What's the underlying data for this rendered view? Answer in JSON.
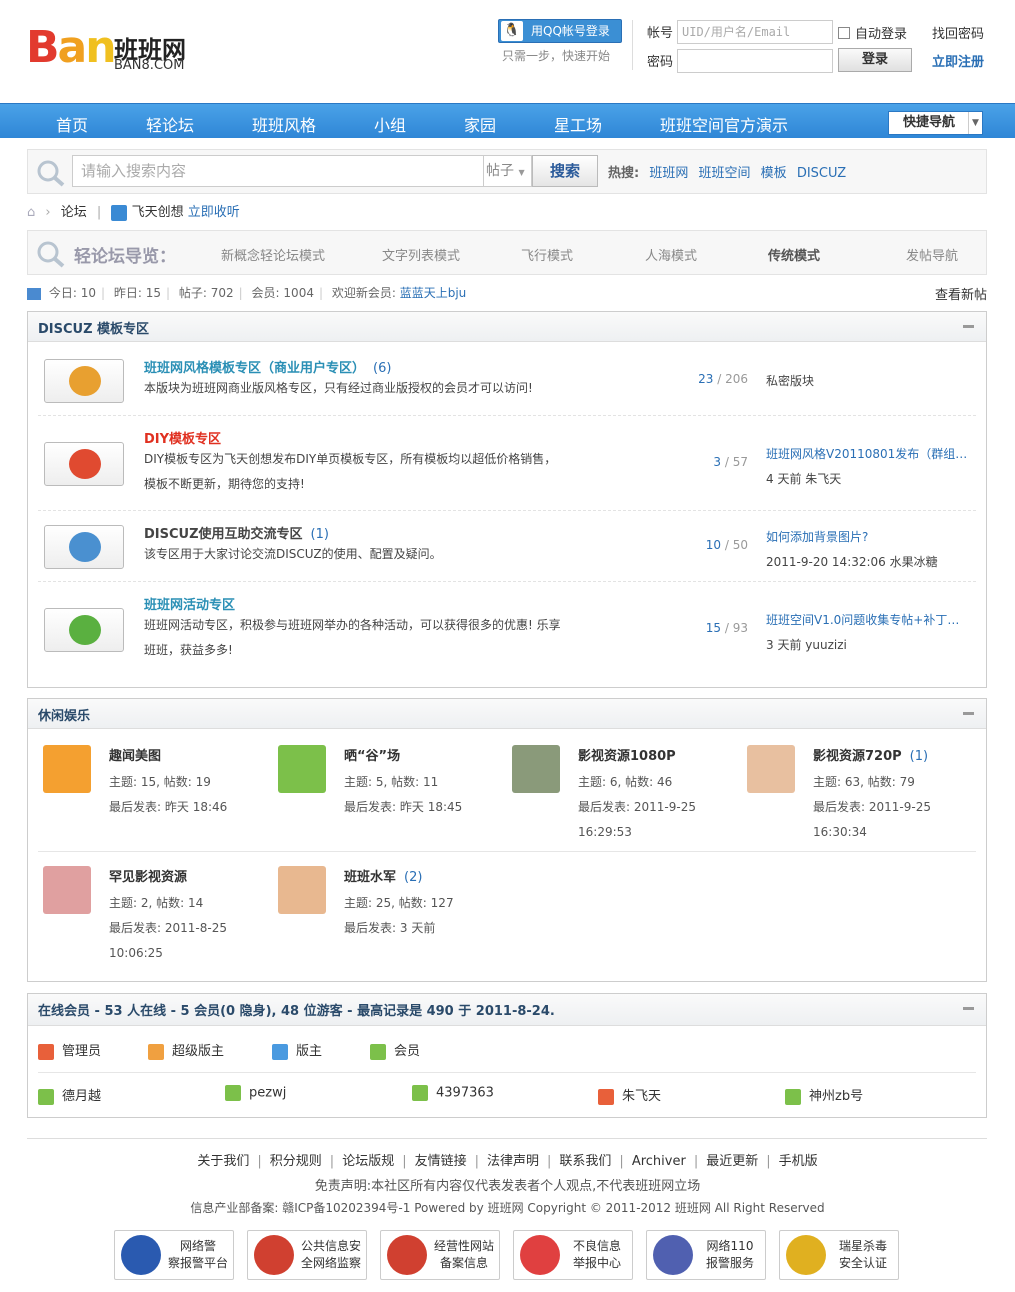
{
  "header": {
    "logo_text": "Ban",
    "logo_cn": "班班网",
    "logo_en": "BAN8.COM",
    "qq_login": "用QQ帐号登录",
    "qq_tip": "只需一步，快速开始",
    "account_label": "帐号",
    "account_placeholder": "UID/用户名/Email",
    "password_label": "密码",
    "auto_login": "自动登录",
    "login_btn": "登录",
    "forgot": "找回密码",
    "register": "立即注册"
  },
  "nav": {
    "items": [
      "首页",
      "轻论坛",
      "班班风格",
      "小组",
      "家园",
      "星工场",
      "班班空间官方演示"
    ],
    "quick": "快捷导航"
  },
  "search": {
    "placeholder": "请输入搜索内容",
    "type": "帖子",
    "button": "搜索",
    "hot_label": "热搜:",
    "hot": [
      "班班网",
      "班班空间",
      "模板",
      "DISCUZ"
    ]
  },
  "breadcrumb": {
    "forum": "论坛",
    "radio": "飞天创想",
    "listen": "立即收听"
  },
  "guide": {
    "title": "轻论坛导览：",
    "items": [
      "新概念轻论坛模式",
      "文字列表模式",
      "飞行模式",
      "人海模式",
      "传统模式",
      "发帖导航"
    ]
  },
  "stats": {
    "today_label": "今日:",
    "today": "10",
    "yesterday_label": "昨日:",
    "yesterday": "15",
    "posts_label": "帖子:",
    "posts": "702",
    "members_label": "会员:",
    "members": "1004",
    "welcome_label": "欢迎新会员:",
    "newest": "蓝蓝天上bju",
    "new_posts": "查看新帖"
  },
  "discuz": {
    "title": "DISCUZ 模板专区",
    "forums": [
      {
        "name": "班班网风格模板专区（商业用户专区）",
        "count": "(6)",
        "desc1": "本版块为班班网商业版风格专区，只有经过商业版授权的会员才可以访问!",
        "desc2": "",
        "topics": "23",
        "posts": "206",
        "last_title": "私密版块",
        "last_time": "",
        "last_user": "",
        "color": "#2a8fb5"
      },
      {
        "name": "DIY模板专区",
        "count": "",
        "desc1": "DIY模板专区为飞天创想发布DIY单页模板专区，所有模板均以超低价格销售，",
        "desc2": "模板不断更新，期待您的支持!",
        "topics": "3",
        "posts": "57",
        "last_title": "班班网风格V20110801发布（群组…",
        "last_time": "4 天前",
        "last_user": "朱飞天",
        "color": "#e03020"
      },
      {
        "name": "DISCUZ使用互助交流专区",
        "count": "(1)",
        "desc1": "该专区用于大家讨论交流DISCUZ的使用、配置及疑问。",
        "desc2": "",
        "topics": "10",
        "posts": "50",
        "last_title": "如何添加背景图片?",
        "last_time": "2011-9-20 14:32:06",
        "last_user": "水果冰糖",
        "color": "#444444"
      },
      {
        "name": "班班网活动专区",
        "count": "",
        "desc1": "班班网活动专区，积极参与班班网举办的各种活动，可以获得很多的优惠! 乐享",
        "desc2": "班班，获益多多!",
        "topics": "15",
        "posts": "93",
        "last_title": "班班空间V1.0问题收集专帖+补丁…",
        "last_time": "3 天前",
        "last_user": "yuuzizi",
        "color": "#2a8fb5"
      }
    ]
  },
  "leisure": {
    "title": "休闲娱乐",
    "groups": [
      {
        "name": "趣闻美图",
        "count": "",
        "topics_label": "主题:",
        "topics": "15",
        "posts_label": "帖数:",
        "posts": "19",
        "last_label": "最后发表:",
        "last": "昨天 18:46",
        "last2": "",
        "color": "#f4a030"
      },
      {
        "name": "晒“谷”场",
        "count": "",
        "topics_label": "主题:",
        "topics": "5",
        "posts_label": "帖数:",
        "posts": "11",
        "last_label": "最后发表:",
        "last": "昨天 18:45",
        "last2": "",
        "color": "#7cc04a"
      },
      {
        "name": "影视资源1080P",
        "count": "",
        "topics_label": "主题:",
        "topics": "6",
        "posts_label": "帖数:",
        "posts": "46",
        "last_label": "最后发表:",
        "last": "2011-9-25",
        "last2": "16:29:53",
        "color": "#8a9a7a"
      },
      {
        "name": "影视资源720P",
        "count": "(1)",
        "topics_label": "主题:",
        "topics": "63",
        "posts_label": "帖数:",
        "posts": "79",
        "last_label": "最后发表:",
        "last": "2011-9-25",
        "last2": "16:30:34",
        "color": "#e8c0a0"
      },
      {
        "name": "罕见影视资源",
        "count": "",
        "topics_label": "主题:",
        "topics": "2",
        "posts_label": "帖数:",
        "posts": "14",
        "last_label": "最后发表:",
        "last": "2011-8-25",
        "last2": "10:06:25",
        "color": "#e0a0a0"
      },
      {
        "name": "班班水军",
        "count": "(2)",
        "topics_label": "主题:",
        "topics": "25",
        "posts_label": "帖数:",
        "posts": "127",
        "last_label": "最后发表:",
        "last": "3 天前",
        "last2": "",
        "color": "#e8b890"
      }
    ]
  },
  "online": {
    "title": "在线会员 - 53 人在线 - 5 会员(0 隐身), 48 位游客 - 最高记录是 490 于 2011-8-24.",
    "roles": [
      {
        "label": "管理员",
        "color": "#e8603a"
      },
      {
        "label": "超级版主",
        "color": "#f0a040"
      },
      {
        "label": "版主",
        "color": "#4a9ae0"
      },
      {
        "label": "会员",
        "color": "#7cc04a"
      }
    ],
    "users": [
      {
        "name": "德月越",
        "color": "#7cc04a"
      },
      {
        "name": "pezwj",
        "color": "#7cc04a"
      },
      {
        "name": "4397363",
        "color": "#7cc04a"
      },
      {
        "name": "朱飞天",
        "color": "#e8603a"
      },
      {
        "name": "神州zb号",
        "color": "#7cc04a"
      }
    ]
  },
  "footer": {
    "links": [
      "关于我们",
      "积分规则",
      "论坛版规",
      "友情链接",
      "法律声明",
      "联系我们",
      "Archiver",
      "最近更新",
      "手机版"
    ],
    "declaration": "免责声明:本社区所有内容仅代表发表者个人观点,不代表班班网立场",
    "copyright": "信息产业部备案: 赣ICP备10202394号-1 Powered by 班班网 Copyright © 2011-2012 班班网 All Right Reserved",
    "badges": [
      {
        "l1": "网络警",
        "l2": "察报警平台",
        "color": "#2a5ab0"
      },
      {
        "l1": "公共信息安",
        "l2": "全网络监察",
        "color": "#d04030"
      },
      {
        "l1": "经营性网站",
        "l2": "备案信息",
        "color": "#d04030"
      },
      {
        "l1": "不良信息",
        "l2": "举报中心",
        "color": "#e04040"
      },
      {
        "l1": "网络110",
        "l2": "报警服务",
        "color": "#5060b0"
      },
      {
        "l1": "瑞星杀毒",
        "l2": "安全认证",
        "color": "#e0b020"
      }
    ]
  }
}
